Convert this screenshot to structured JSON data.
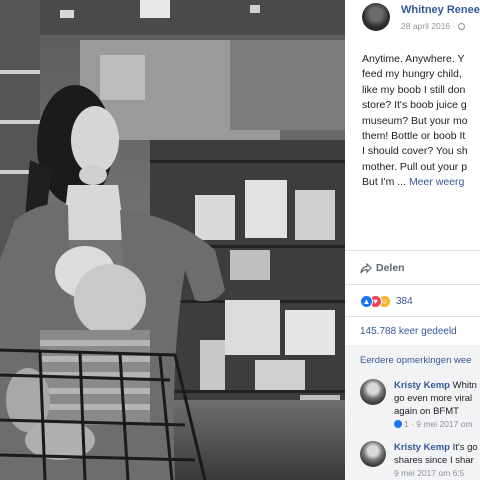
{
  "post": {
    "author": "Whitney Renee",
    "date": "28 april 2016 ·",
    "text_lines": [
      "Anytime. Anywhere. Y",
      "feed my hungry child,",
      "like my boob I still don",
      "store? It's boob juice g",
      "museum? But your mo",
      "them! Bottle or boob It",
      "I should cover? You sh",
      "mother. Pull out your p",
      "But I'm ..."
    ],
    "see_more": "Meer weerg"
  },
  "actions": {
    "share_label": "Delen"
  },
  "reactions": {
    "count": "384",
    "types": [
      "like",
      "love",
      "haha"
    ],
    "colors": {
      "like": "#1877f2",
      "love": "#f33e58",
      "haha": "#f7b125"
    }
  },
  "shares": {
    "label": "145.788 keer gedeeld"
  },
  "comments": {
    "earlier_label": "Eerdere opmerkingen wee",
    "items": [
      {
        "author": "Kristy Kemp",
        "text_first": "Whitn",
        "lines": [
          "go even more viral",
          "again on BFMT"
        ],
        "likes": "1",
        "time": "· 9 mei 2017 om"
      },
      {
        "author": "Kristy Kemp",
        "text_first": "It's go",
        "lines": [
          "shares since I shar"
        ],
        "likes": "",
        "time": "9 mei 2017 om 6:5"
      }
    ]
  },
  "colors": {
    "link": "#365899",
    "muted": "#90949c",
    "comments_bg": "#f2f3f5"
  }
}
